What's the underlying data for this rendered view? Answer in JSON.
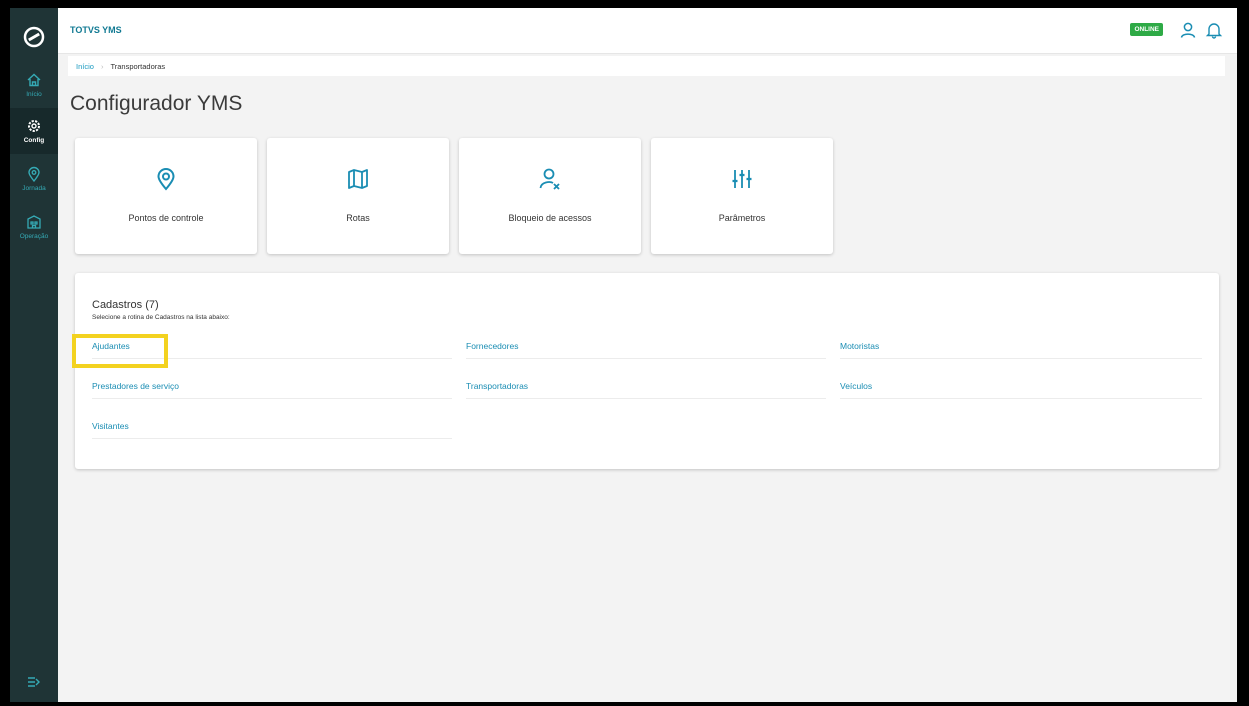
{
  "header": {
    "app_title": "TOTVS YMS",
    "status_badge": "ONLINE"
  },
  "sidebar": {
    "items": [
      {
        "label": "Início",
        "icon": "home-icon"
      },
      {
        "label": "Config",
        "icon": "gear-icon",
        "active": true
      },
      {
        "label": "Jornada",
        "icon": "location-icon"
      },
      {
        "label": "Operação",
        "icon": "building-icon"
      }
    ]
  },
  "breadcrumb": {
    "home": "Início",
    "current": "Transportadoras"
  },
  "page": {
    "title": "Configurador YMS"
  },
  "cards": [
    {
      "label": "Pontos de controle",
      "icon": "location-pin-icon"
    },
    {
      "label": "Rotas",
      "icon": "map-icon"
    },
    {
      "label": "Bloqueio de acessos",
      "icon": "user-blocked-icon"
    },
    {
      "label": "Parâmetros",
      "icon": "sliders-icon"
    }
  ],
  "cadastros": {
    "title": "Cadastros (7)",
    "subtitle": "Selecione a rotina de Cadastros na lista abaixo:",
    "items": [
      "Ajudantes",
      "Fornecedores",
      "Motoristas",
      "Prestadores de serviço",
      "Transportadoras",
      "Veículos",
      "Visitantes"
    ]
  },
  "colors": {
    "accent": "#1a8db3",
    "sidebar": "#1f3436",
    "online": "#2eaa46",
    "highlight": "#f3d21f"
  }
}
